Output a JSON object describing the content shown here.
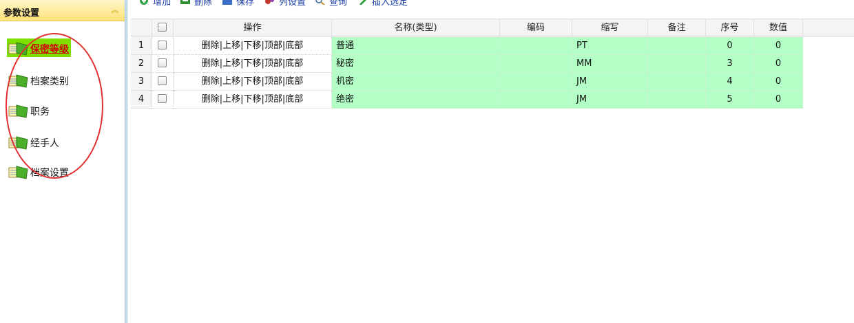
{
  "sidebar": {
    "title": "参数设置",
    "items": [
      {
        "label": "保密等级",
        "active": true
      },
      {
        "label": "档案类别",
        "active": false
      },
      {
        "label": "职务",
        "active": false
      },
      {
        "label": "经手人",
        "active": false
      },
      {
        "label": "档案设置",
        "active": false
      }
    ]
  },
  "toolbar": {
    "add": "增加",
    "delete": "删除",
    "save": "保存",
    "column_settings": "列设置",
    "query": "查询",
    "insert_selection": "插入选定"
  },
  "grid": {
    "columns": [
      "操作",
      "名称(类型)",
      "编码",
      "缩写",
      "备注",
      "序号",
      "数值"
    ],
    "row_actions": [
      "删除",
      "上移",
      "下移",
      "顶部",
      "底部"
    ],
    "rows": [
      {
        "num": "1",
        "name": "普通",
        "code": "",
        "abbr": "PT",
        "note": "",
        "seq": "0",
        "value": "0"
      },
      {
        "num": "2",
        "name": "秘密",
        "code": "",
        "abbr": "MM",
        "note": "",
        "seq": "3",
        "value": "0"
      },
      {
        "num": "3",
        "name": "机密",
        "code": "",
        "abbr": "JM",
        "note": "",
        "seq": "4",
        "value": "0"
      },
      {
        "num": "4",
        "name": "绝密",
        "code": "",
        "abbr": "JM",
        "note": "",
        "seq": "5",
        "value": "0"
      }
    ]
  },
  "colors": {
    "row_highlight": "#b3ffc6",
    "active_nav_bg": "#7fe000",
    "active_nav_text": "#d00000",
    "annotation": "#e03030"
  },
  "icons": [
    "folder-file-icon",
    "add-icon",
    "delete-icon",
    "save-icon",
    "column-settings-icon",
    "search-icon",
    "edit-pencil-icon",
    "collapse-chevron-icon"
  ]
}
